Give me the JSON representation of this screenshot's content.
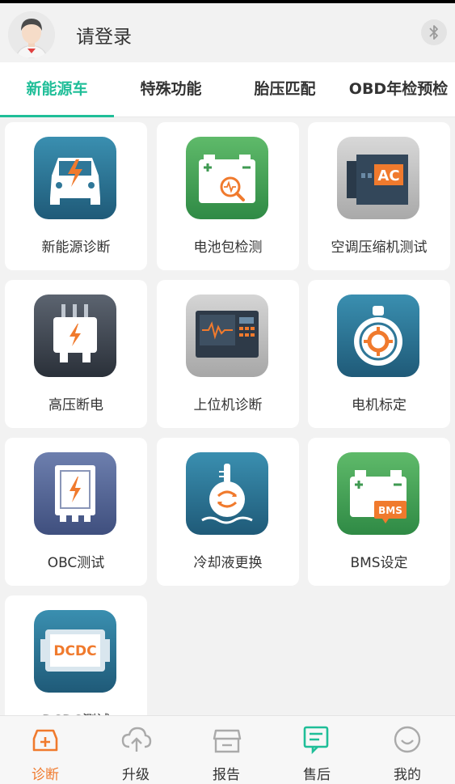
{
  "header": {
    "login_text": "请登录",
    "bluetooth_icon": "bluetooth-icon",
    "avatar_icon": "user-avatar"
  },
  "tabs": [
    {
      "label": "新能源车",
      "active": true
    },
    {
      "label": "特殊功能",
      "active": false
    },
    {
      "label": "胎压匹配",
      "active": false
    },
    {
      "label": "OBD年检预检",
      "active": false
    }
  ],
  "functions": [
    {
      "label": "新能源诊断",
      "icon": "ev-car-icon"
    },
    {
      "label": "电池包检测",
      "icon": "battery-pack-icon"
    },
    {
      "label": "空调压缩机测试",
      "icon": "ac-compressor-icon"
    },
    {
      "label": "高压断电",
      "icon": "high-voltage-icon"
    },
    {
      "label": "上位机诊断",
      "icon": "host-computer-icon"
    },
    {
      "label": "电机标定",
      "icon": "motor-icon"
    },
    {
      "label": "OBC测试",
      "icon": "obc-icon"
    },
    {
      "label": "冷却液更换",
      "icon": "coolant-icon"
    },
    {
      "label": "BMS设定",
      "icon": "bms-icon"
    },
    {
      "label": "DCDC测试",
      "icon": "dcdc-icon"
    }
  ],
  "icon_texts": {
    "ac": "AC",
    "bms": "BMS",
    "dcdc": "DCDC"
  },
  "bottom_nav": [
    {
      "label": "诊断",
      "icon": "diagnosis-icon",
      "active": true
    },
    {
      "label": "升级",
      "icon": "cloud-upload-icon",
      "active": false
    },
    {
      "label": "报告",
      "icon": "report-icon",
      "active": false
    },
    {
      "label": "售后",
      "icon": "after-sales-icon",
      "active": false
    },
    {
      "label": "我的",
      "icon": "smile-icon",
      "active": false
    }
  ],
  "colors": {
    "accent": "#1fbe98",
    "active_nav": "#f07a2d"
  }
}
